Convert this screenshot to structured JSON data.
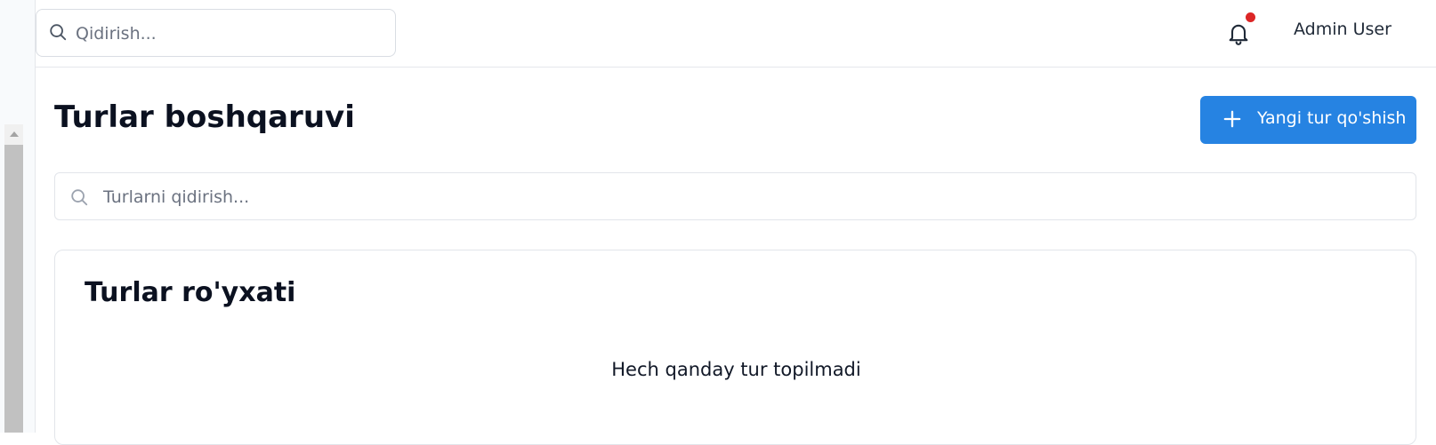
{
  "topbar": {
    "search_placeholder": "Qidirish...",
    "user_name": "Admin User",
    "notification_dot_color": "#dc2626"
  },
  "page": {
    "title": "Turlar boshqaruvi",
    "add_button_label": "Yangi tur qo'shish",
    "search_placeholder": "Turlarni qidirish..."
  },
  "card": {
    "title": "Turlar ro'yxati",
    "empty_message": "Hech qanday tur topilmadi"
  },
  "icons": {
    "top_search": "search-icon",
    "notifications": "bell-icon",
    "add": "plus-icon",
    "main_search": "search-icon"
  },
  "colors": {
    "accent": "#2683e2"
  }
}
